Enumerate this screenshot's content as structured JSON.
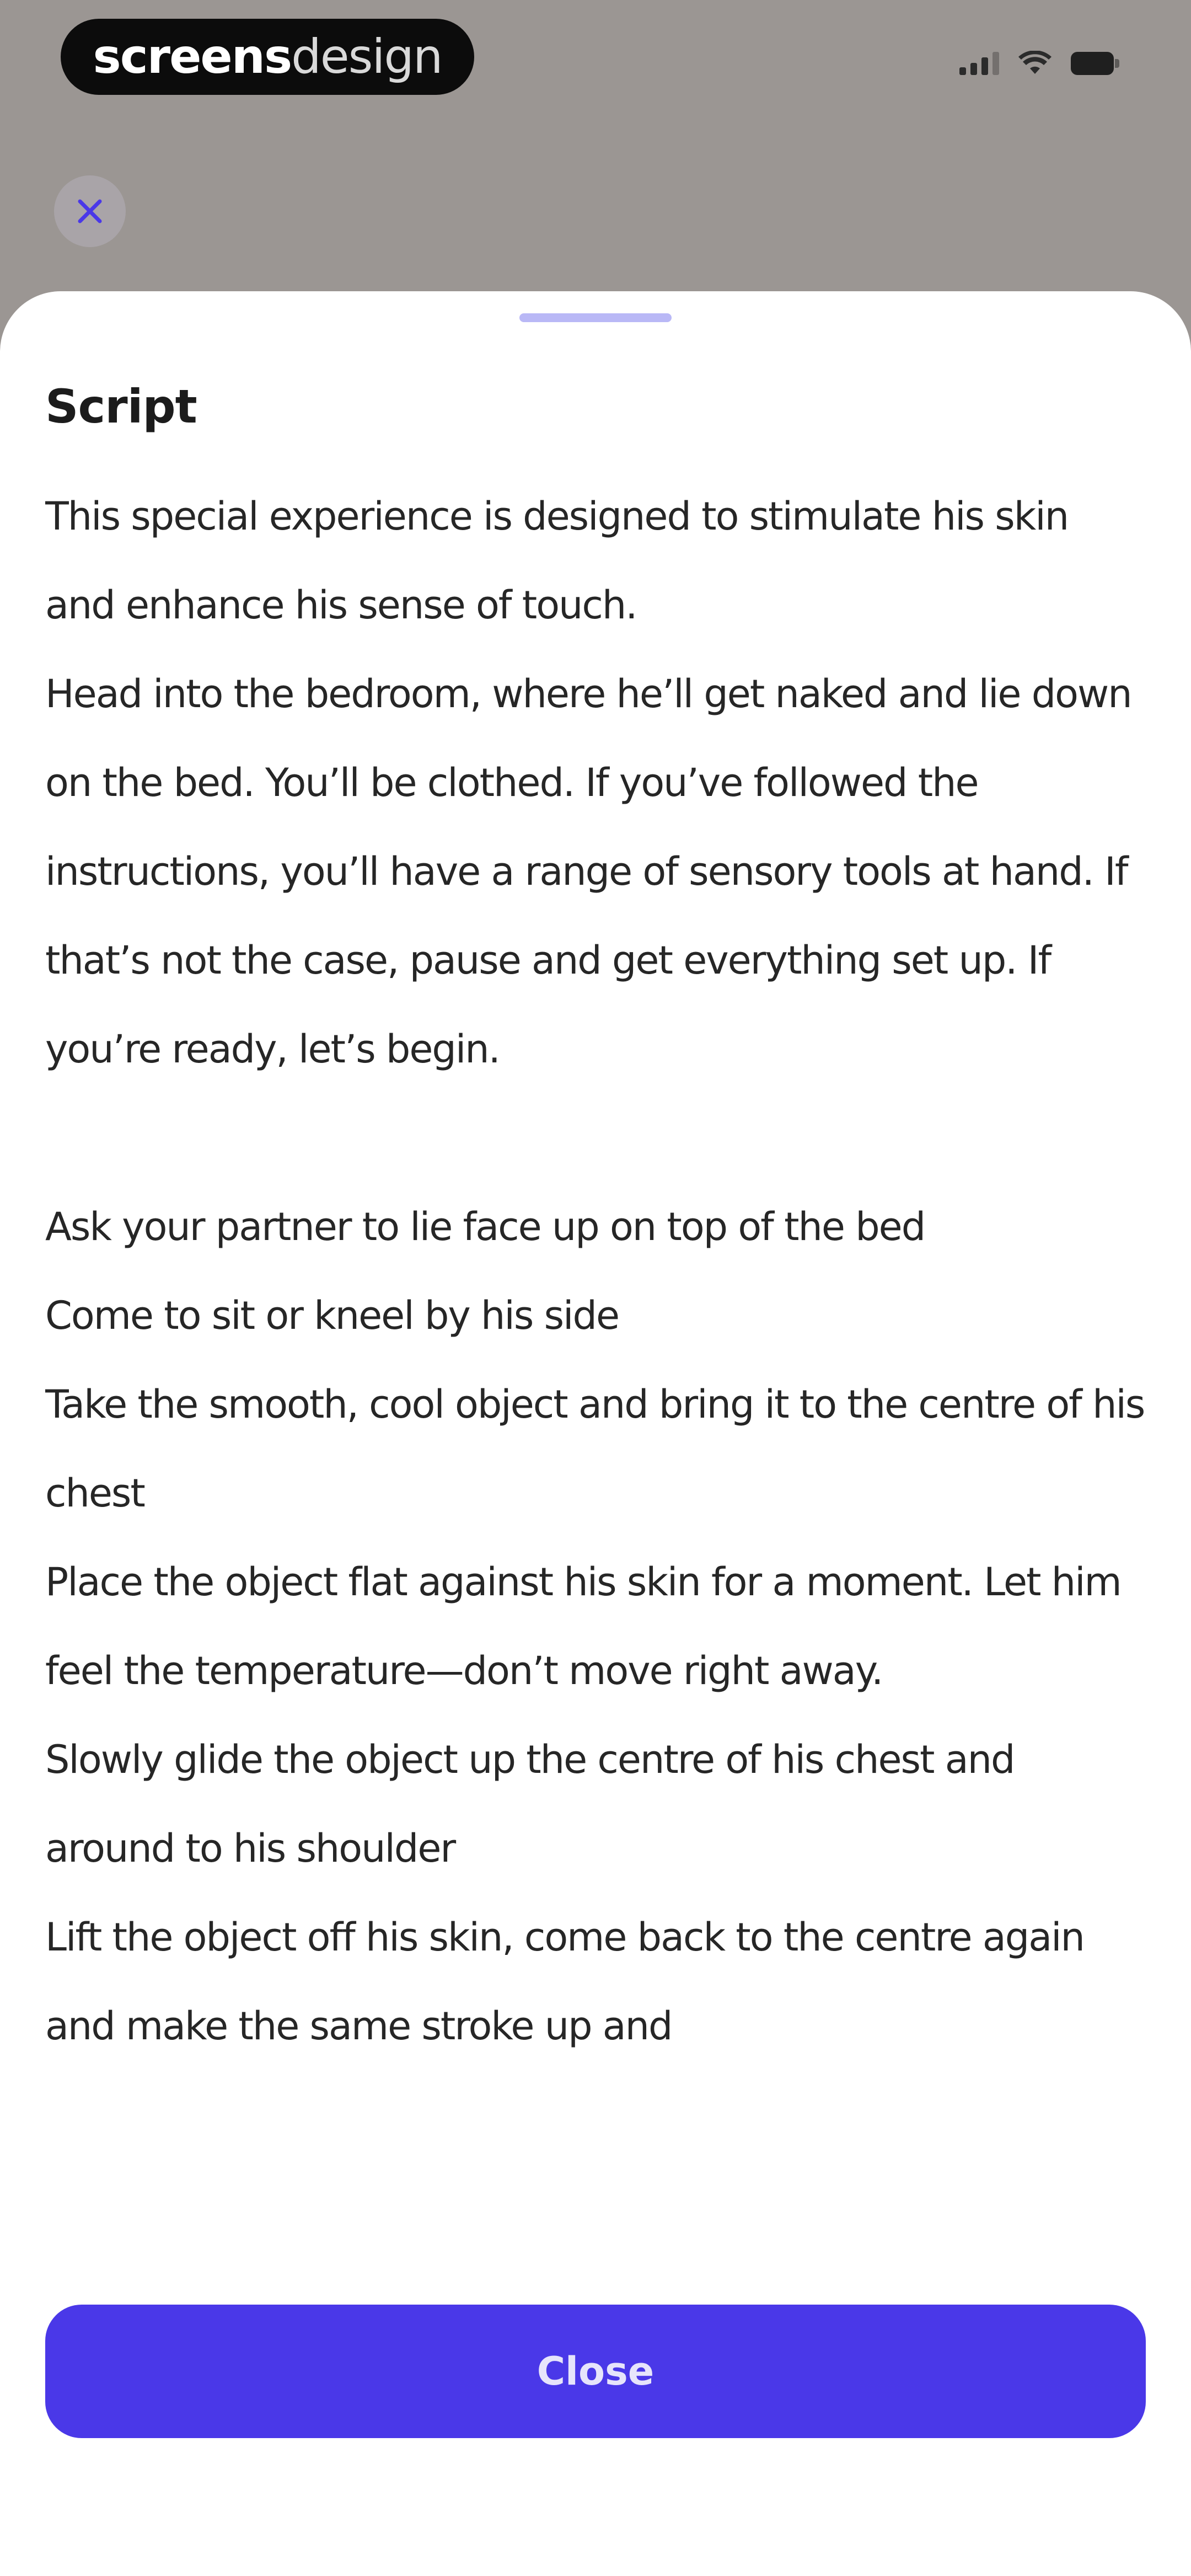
{
  "status_bar": {
    "brand_strong": "screens",
    "brand_light": "design",
    "icons": [
      "signal-icon",
      "wifi-icon",
      "battery-icon"
    ]
  },
  "header": {
    "close_icon": "close-icon",
    "close_icon_color": "#4a38e8"
  },
  "sheet": {
    "title": "Script",
    "paragraphs": [
      "This special experience is designed to stimulate his skin and enhance his sense of touch.",
      "Head into the bedroom, where he’ll get naked and lie down on the bed. You’ll be clothed. If you’ve followed the instructions, you’ll have a range of sensory tools at hand. If that’s not the case, pause and get everything set up. If you’re ready, let’s begin.",
      "",
      "Ask your partner to lie face up on top of the bed",
      "Come to sit or kneel by his side",
      "Take the smooth, cool object and bring it to the centre of his chest",
      "Place the object flat against his skin for a moment. Let him feel the temperature—don’t move right away.",
      "Slowly glide the object up the centre of his chest and around to his shoulder",
      "Lift the object off his skin, come back to the centre again and make the same stroke up and"
    ],
    "close_button_label": "Close"
  },
  "colors": {
    "accent": "#4a38e8",
    "backdrop": "#9b9693",
    "handle": "#b9b8f6"
  }
}
